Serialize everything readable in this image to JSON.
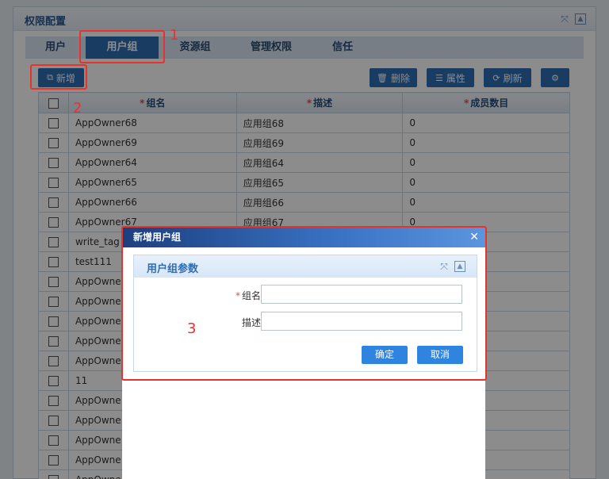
{
  "panel": {
    "title": "权限配置"
  },
  "tabs": [
    {
      "label": "用户"
    },
    {
      "label": "用户组"
    },
    {
      "label": "资源组"
    },
    {
      "label": "管理权限"
    },
    {
      "label": "信任"
    }
  ],
  "toolbar": {
    "add": "新增",
    "delete": "删除",
    "properties": "属性",
    "refresh": "刷新"
  },
  "table": {
    "columns": [
      "组名",
      "描述",
      "成员数目"
    ],
    "rows": [
      {
        "name": "AppOwner68",
        "desc": "应用组68",
        "count": "0"
      },
      {
        "name": "AppOwner69",
        "desc": "应用组69",
        "count": "0"
      },
      {
        "name": "AppOwner64",
        "desc": "应用组64",
        "count": "0"
      },
      {
        "name": "AppOwner65",
        "desc": "应用组65",
        "count": "0"
      },
      {
        "name": "AppOwner66",
        "desc": "应用组66",
        "count": "0"
      },
      {
        "name": "AppOwner67",
        "desc": "应用组67",
        "count": "0"
      },
      {
        "name": "write_tag",
        "desc": "",
        "count": ""
      },
      {
        "name": "test111",
        "desc": "",
        "count": ""
      },
      {
        "name": "AppOwne",
        "desc": "",
        "count": ""
      },
      {
        "name": "AppOwne",
        "desc": "",
        "count": ""
      },
      {
        "name": "AppOwne",
        "desc": "",
        "count": ""
      },
      {
        "name": "AppOwne",
        "desc": "",
        "count": ""
      },
      {
        "name": "AppOwne",
        "desc": "",
        "count": ""
      },
      {
        "name": "11",
        "desc": "",
        "count": ""
      },
      {
        "name": "AppOwne",
        "desc": "",
        "count": ""
      },
      {
        "name": "AppOwne",
        "desc": "",
        "count": ""
      },
      {
        "name": "AppOwne",
        "desc": "",
        "count": ""
      },
      {
        "name": "AppOwne",
        "desc": "",
        "count": ""
      },
      {
        "name": "AppOwne",
        "desc": "",
        "count": ""
      }
    ]
  },
  "dialog": {
    "title": "新增用户组",
    "fieldset_title": "用户组参数",
    "name_label": "组名",
    "desc_label": "描述",
    "name_value": "",
    "desc_value": "",
    "ok": "确定",
    "cancel": "取消"
  },
  "annotations": {
    "one": "1",
    "two": "2",
    "three": "3"
  },
  "colors": {
    "accent": "#2f6db3",
    "annotation": "#e8322e"
  }
}
